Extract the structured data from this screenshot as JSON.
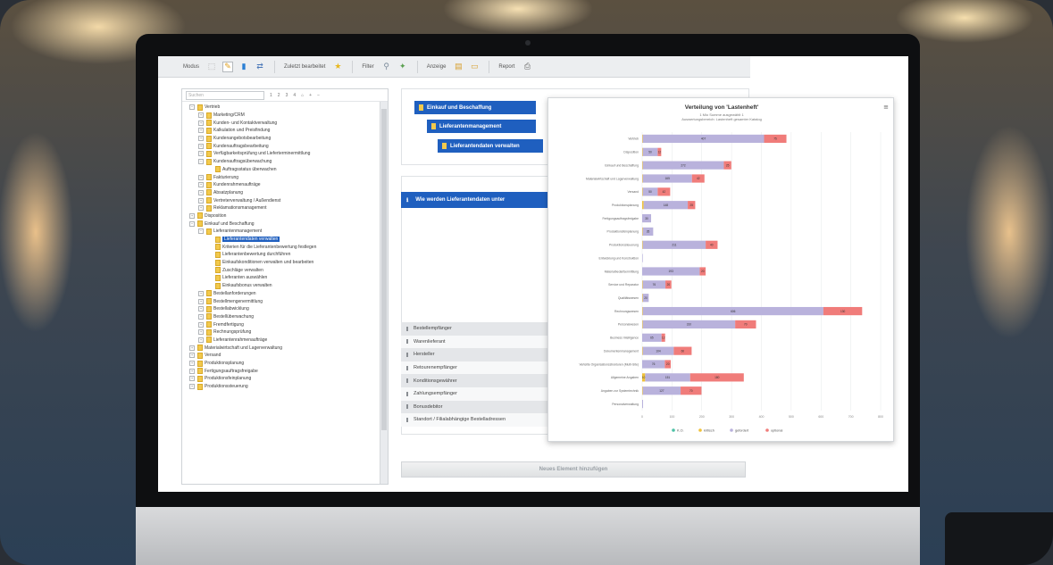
{
  "toolbar": {
    "modus_label": "Modus",
    "zuletzt_label": "Zuletzt bearbeitet",
    "filter_label": "Filter",
    "anzeige_label": "Anzeige",
    "report_label": "Report"
  },
  "tree": {
    "search_placeholder": "Suchen",
    "levels": [
      "1",
      "2",
      "3",
      "4"
    ],
    "nodes": [
      {
        "label": "Vertrieb",
        "depth": 0,
        "toggle": "−"
      },
      {
        "label": "Marketing/CRM",
        "depth": 1,
        "toggle": "+"
      },
      {
        "label": "Kunden- und Kontaktverwaltung",
        "depth": 1,
        "toggle": "+"
      },
      {
        "label": "Kalkulation und Preisfindung",
        "depth": 1,
        "toggle": "+"
      },
      {
        "label": "Kundenangebotsbearbeitung",
        "depth": 1,
        "toggle": "+"
      },
      {
        "label": "Kundenauftragsbearbeitung",
        "depth": 1,
        "toggle": "+"
      },
      {
        "label": "Verfügbarkeitsprüfung und Lieferterminermittlung",
        "depth": 1,
        "toggle": "+"
      },
      {
        "label": "Kundenauftragsüberwachung",
        "depth": 1,
        "toggle": "−"
      },
      {
        "label": "Auftragsstatus überwachen",
        "depth": 2,
        "toggle": ""
      },
      {
        "label": "Fakturierung",
        "depth": 1,
        "toggle": "+"
      },
      {
        "label": "Kundenrahmenaufträge",
        "depth": 1,
        "toggle": "+"
      },
      {
        "label": "Absatzplanung",
        "depth": 1,
        "toggle": "+"
      },
      {
        "label": "Vertreterverwaltung / Außendienst",
        "depth": 1,
        "toggle": "+"
      },
      {
        "label": "Reklamationsmanagement",
        "depth": 1,
        "toggle": "+"
      },
      {
        "label": "Disposition",
        "depth": 0,
        "toggle": "+"
      },
      {
        "label": "Einkauf und Beschaffung",
        "depth": 0,
        "toggle": "−"
      },
      {
        "label": "Lieferantenmanagement",
        "depth": 1,
        "toggle": "−"
      },
      {
        "label": "Lieferantendaten verwalten",
        "depth": 2,
        "toggle": "",
        "selected": true
      },
      {
        "label": "Kriterien für die Lieferantenbewertung festlegen",
        "depth": 2,
        "toggle": ""
      },
      {
        "label": "Lieferantenbewertung durchführen",
        "depth": 2,
        "toggle": ""
      },
      {
        "label": "Einkaufskonditionen verwalten und bearbeiten",
        "depth": 2,
        "toggle": ""
      },
      {
        "label": "Zuschläge verwalten",
        "depth": 2,
        "toggle": ""
      },
      {
        "label": "Lieferanten auswählen",
        "depth": 2,
        "toggle": ""
      },
      {
        "label": "Einkaufsbonus verwalten",
        "depth": 2,
        "toggle": ""
      },
      {
        "label": "Bestellanforderungen",
        "depth": 1,
        "toggle": "+"
      },
      {
        "label": "Bestellmengenermittlung",
        "depth": 1,
        "toggle": "+"
      },
      {
        "label": "Bestellabwicklung",
        "depth": 1,
        "toggle": "+"
      },
      {
        "label": "Bestellüberwachung",
        "depth": 1,
        "toggle": "+"
      },
      {
        "label": "Fremdfertigung",
        "depth": 1,
        "toggle": "+"
      },
      {
        "label": "Rechnungsprüfung",
        "depth": 1,
        "toggle": "+"
      },
      {
        "label": "Lieferantenrahmenaufträge",
        "depth": 1,
        "toggle": "+"
      },
      {
        "label": "Materialwirtschaft und Lagerverwaltung",
        "depth": 0,
        "toggle": "+"
      },
      {
        "label": "Versand",
        "depth": 0,
        "toggle": "+"
      },
      {
        "label": "Produktionsplanung",
        "depth": 0,
        "toggle": "+"
      },
      {
        "label": "Fertigungsauftragsfreigabe",
        "depth": 0,
        "toggle": "+"
      },
      {
        "label": "Produktionsfeinplanung",
        "depth": 0,
        "toggle": "+"
      },
      {
        "label": "Produktionssteuerung",
        "depth": 0,
        "toggle": "+"
      }
    ]
  },
  "breadcrumb": [
    "Einkauf und Beschaffung",
    "Lieferantenmanagement",
    "Lieferantendaten verwalten"
  ],
  "question": {
    "title": "Wie werden Lieferantendaten unter",
    "rows": [
      "Bestellempfänger",
      "Warenlieferant",
      "Hersteller",
      "Retourenempfänger",
      "Konditionsgewährer",
      "Zahlungsempfänger",
      "Bonusdebitor",
      "Standort / Filialabhängige Bestelladressen"
    ],
    "add_button": "Neues Element hinzufügen"
  },
  "colors": {
    "accent": "#1f5fbf",
    "ko": "#4fc1a6",
    "kritisch": "#f0c23a",
    "gefordert": "#b9b2dc",
    "optional": "#f07c7a"
  },
  "chart_data": {
    "type": "bar",
    "orientation": "horizontal",
    "stacked": true,
    "title": "Verteilung von 'Lastenheft'",
    "subtitle_1": "1 Mio Summe ausgewählt 1",
    "subtitle_2": "Auswertungsbereich: Lastenheft gesamter Katalog",
    "categories": [
      "Vertrieb",
      "Disposition",
      "Einkauf und Beschaffung",
      "Materialwirtschaft und Lagerverwaltung",
      "Versand",
      "Produktionsplanung",
      "Fertigungsauftragsfreigabe",
      "Produktionsfeinplanung",
      "Produktionssteuerung",
      "Entwicklung und Konstruktion",
      "Materialbedarfsermittlung",
      "Service und Reparatur",
      "Qualitätswesen",
      "Rechnungswesen",
      "Personalwesen",
      "Business Intelligence",
      "Dokumentenmanagement",
      "Verteilte Organisationsstrukturen (Multi-Site)",
      "Allgemeine Angaben",
      "Angaben zur Systemtechnik",
      "Personalverwaltung"
    ],
    "series": [
      {
        "name": "K.O.",
        "values": [
          0,
          0,
          0,
          0,
          0,
          0,
          0,
          0,
          0,
          0,
          0,
          0,
          0,
          0,
          0,
          0,
          0,
          0,
          0,
          0,
          0
        ]
      },
      {
        "name": "kritisch",
        "values": [
          2,
          2,
          2,
          2,
          2,
          5,
          0,
          2,
          2,
          0,
          0,
          2,
          2,
          2,
          2,
          0,
          2,
          0,
          10,
          2,
          0
        ]
      },
      {
        "name": "gefordert",
        "values": [
          407,
          50,
          272,
          165,
          50,
          148,
          30,
          35,
          211,
          2,
          193,
          76,
          20,
          606,
          310,
          65,
          104,
          76,
          151,
          127,
          3
        ]
      },
      {
        "name": "optional",
        "values": [
          75,
          12,
          25,
          42,
          42,
          25,
          0,
          0,
          40,
          0,
          20,
          20,
          0,
          130,
          70,
          12,
          60,
          20,
          180,
          70,
          0
        ]
      }
    ],
    "xlim": [
      0,
      800
    ],
    "xticks": [
      "0",
      "100",
      "200",
      "300",
      "400",
      "500",
      "600",
      "700",
      "800"
    ],
    "legend_position": "bottom"
  }
}
